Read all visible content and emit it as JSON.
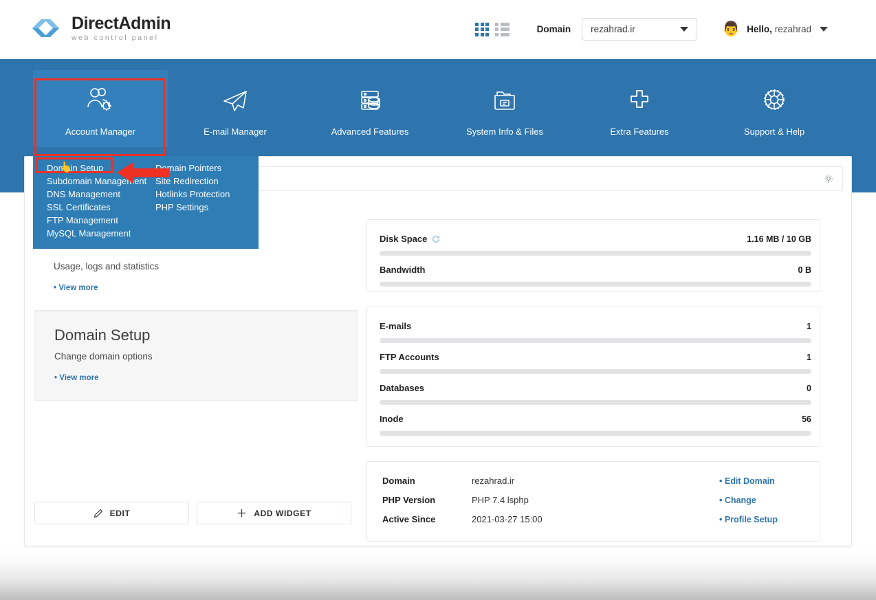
{
  "brand": {
    "title": "DirectAdmin",
    "subtitle": "web control panel",
    "logo_icon": "chevron-double-right-logo",
    "accent_color": "#2E74AD",
    "logo_color_dark": "#2E74AD",
    "logo_color_light": "#6FB1DE"
  },
  "header": {
    "grid_view_icon": "grid-view-icon",
    "list_view_icon": "list-view-icon",
    "domain_label": "Domain",
    "domain_selected": "rezahrad.ir",
    "domain_caret_icon": "chevron-down-icon",
    "avatar_icon": "user-avatar",
    "greeting_prefix": "Hello,",
    "user_name": "rezahrad",
    "user_caret_icon": "chevron-down-icon"
  },
  "nav": {
    "items": [
      {
        "label": "Account Manager",
        "icon": "users-gear-icon",
        "active": true
      },
      {
        "label": "E-mail Manager",
        "icon": "paper-plane-icon",
        "active": false
      },
      {
        "label": "Advanced Features",
        "icon": "server-database-icon",
        "active": false
      },
      {
        "label": "System Info & Files",
        "icon": "folder-files-icon",
        "active": false
      },
      {
        "label": "Extra Features",
        "icon": "plus-icon",
        "active": false
      },
      {
        "label": "Support & Help",
        "icon": "life-ring-icon",
        "active": false
      }
    ]
  },
  "dropdown": {
    "left_items": [
      "Domain Setup",
      "Subdomain Management",
      "DNS Management",
      "SSL Certificates",
      "FTP Management",
      "MySQL Management"
    ],
    "right_items": [
      "Domain Pointers",
      "Site Redirection",
      "Hotlinks Protection",
      "PHP Settings"
    ],
    "highlighted_item": "Domain Setup"
  },
  "annotations": {
    "highlight_color": "#ef3124",
    "account_manager_box": "red-highlight-box",
    "domain_setup_box": "red-highlight-box",
    "arrow_icon": "red-left-arrow",
    "cursor_icon": "pointer-hand-cursor"
  },
  "toolbar": {
    "settings_icon": "gear-icon"
  },
  "widgets": [
    {
      "title": "",
      "desc": "Usage, logs and statistics",
      "link": "View more",
      "hover": false
    },
    {
      "title": "Domain Setup",
      "desc": "Change domain options",
      "link": "View more",
      "hover": true
    }
  ],
  "widget_buttons": [
    {
      "label": "EDIT",
      "icon": "pencil-icon"
    },
    {
      "label": "ADD WIDGET",
      "icon": "plus-icon"
    }
  ],
  "usage": {
    "meters": [
      {
        "name": "Disk Space",
        "value": "1.16 MB / 10 GB",
        "percent": 0,
        "icon": "refresh-icon"
      },
      {
        "name": "Bandwidth",
        "value": "0 B",
        "percent": 0,
        "icon": null
      }
    ]
  },
  "counts": {
    "meters": [
      {
        "name": "E-mails",
        "value": "1",
        "percent": 0,
        "icon": null
      },
      {
        "name": "FTP Accounts",
        "value": "1",
        "percent": 0,
        "icon": null
      },
      {
        "name": "Databases",
        "value": "0",
        "percent": 0,
        "icon": null
      },
      {
        "name": "Inode",
        "value": "56",
        "percent": 0,
        "icon": null
      }
    ]
  },
  "account_info": {
    "rows": [
      {
        "key": "Domain",
        "value": "rezahrad.ir",
        "link": "Edit Domain"
      },
      {
        "key": "PHP Version",
        "value": "PHP 7.4 lsphp",
        "link": "Change"
      },
      {
        "key": "Active Since",
        "value": "2021-03-27 15:00",
        "link": "Profile Setup"
      }
    ]
  }
}
